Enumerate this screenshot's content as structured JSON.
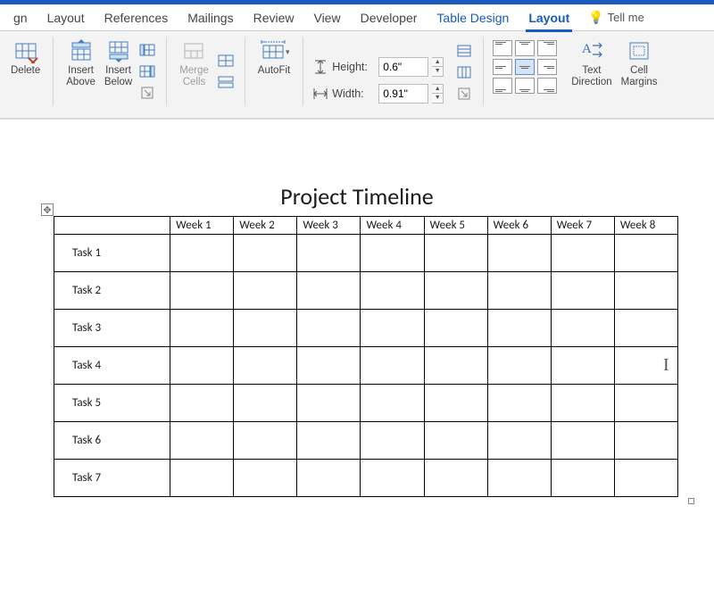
{
  "tabs": {
    "gn": "gn",
    "layout1": "Layout",
    "references": "References",
    "mailings": "Mailings",
    "review": "Review",
    "view": "View",
    "developer": "Developer",
    "tabledesign": "Table Design",
    "layout2": "Layout",
    "tellme": "Tell me"
  },
  "ribbon": {
    "delete": "Delete",
    "insertAbove": "Insert\nAbove",
    "insertBelow": "Insert\nBelow",
    "mergeCells": "Merge\nCells",
    "autofit": "AutoFit",
    "heightLbl": "Height:",
    "heightVal": "0.6\"",
    "widthLbl": "Width:",
    "widthVal": "0.91\"",
    "textDirection": "Text\nDirection",
    "cellMargins": "Cell\nMargins"
  },
  "document": {
    "title": "Project Timeline",
    "columns": [
      "",
      "Week 1",
      "Week 2",
      "Week 3",
      "Week 4",
      "Week 5",
      "Week 6",
      "Week 7",
      "Week 8"
    ],
    "rows": [
      "Task 1",
      "Task 2",
      "Task 3",
      "Task 4",
      "Task 5",
      "Task 6",
      "Task 7"
    ]
  }
}
